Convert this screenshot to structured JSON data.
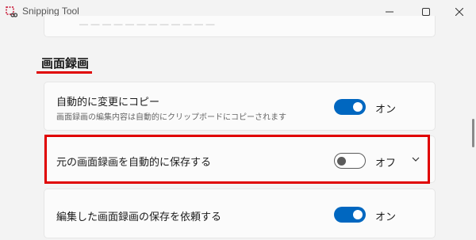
{
  "window": {
    "title": "Snipping Tool",
    "icon": "snipping-tool-icon",
    "controls": [
      "minimize-icon",
      "maximize-icon",
      "close-icon"
    ]
  },
  "section": {
    "heading": "画面録画"
  },
  "settings": [
    {
      "label": "自動的に変更にコピー",
      "description": "画面録画の編集内容は自動的にクリップボードにコピーされます",
      "state": "on",
      "state_label": "オン"
    },
    {
      "label": "元の画面録画を自動的に保存する",
      "state": "off",
      "state_label": "オフ",
      "expand_icon": "chevron-down-icon"
    },
    {
      "label": "編集した画面録画の保存を依頼する",
      "state": "on",
      "state_label": "オン"
    }
  ],
  "colors": {
    "accent": "#0067c0",
    "highlight": "#e00000",
    "background": "#f3f3f3",
    "card": "#fbfbfb"
  }
}
